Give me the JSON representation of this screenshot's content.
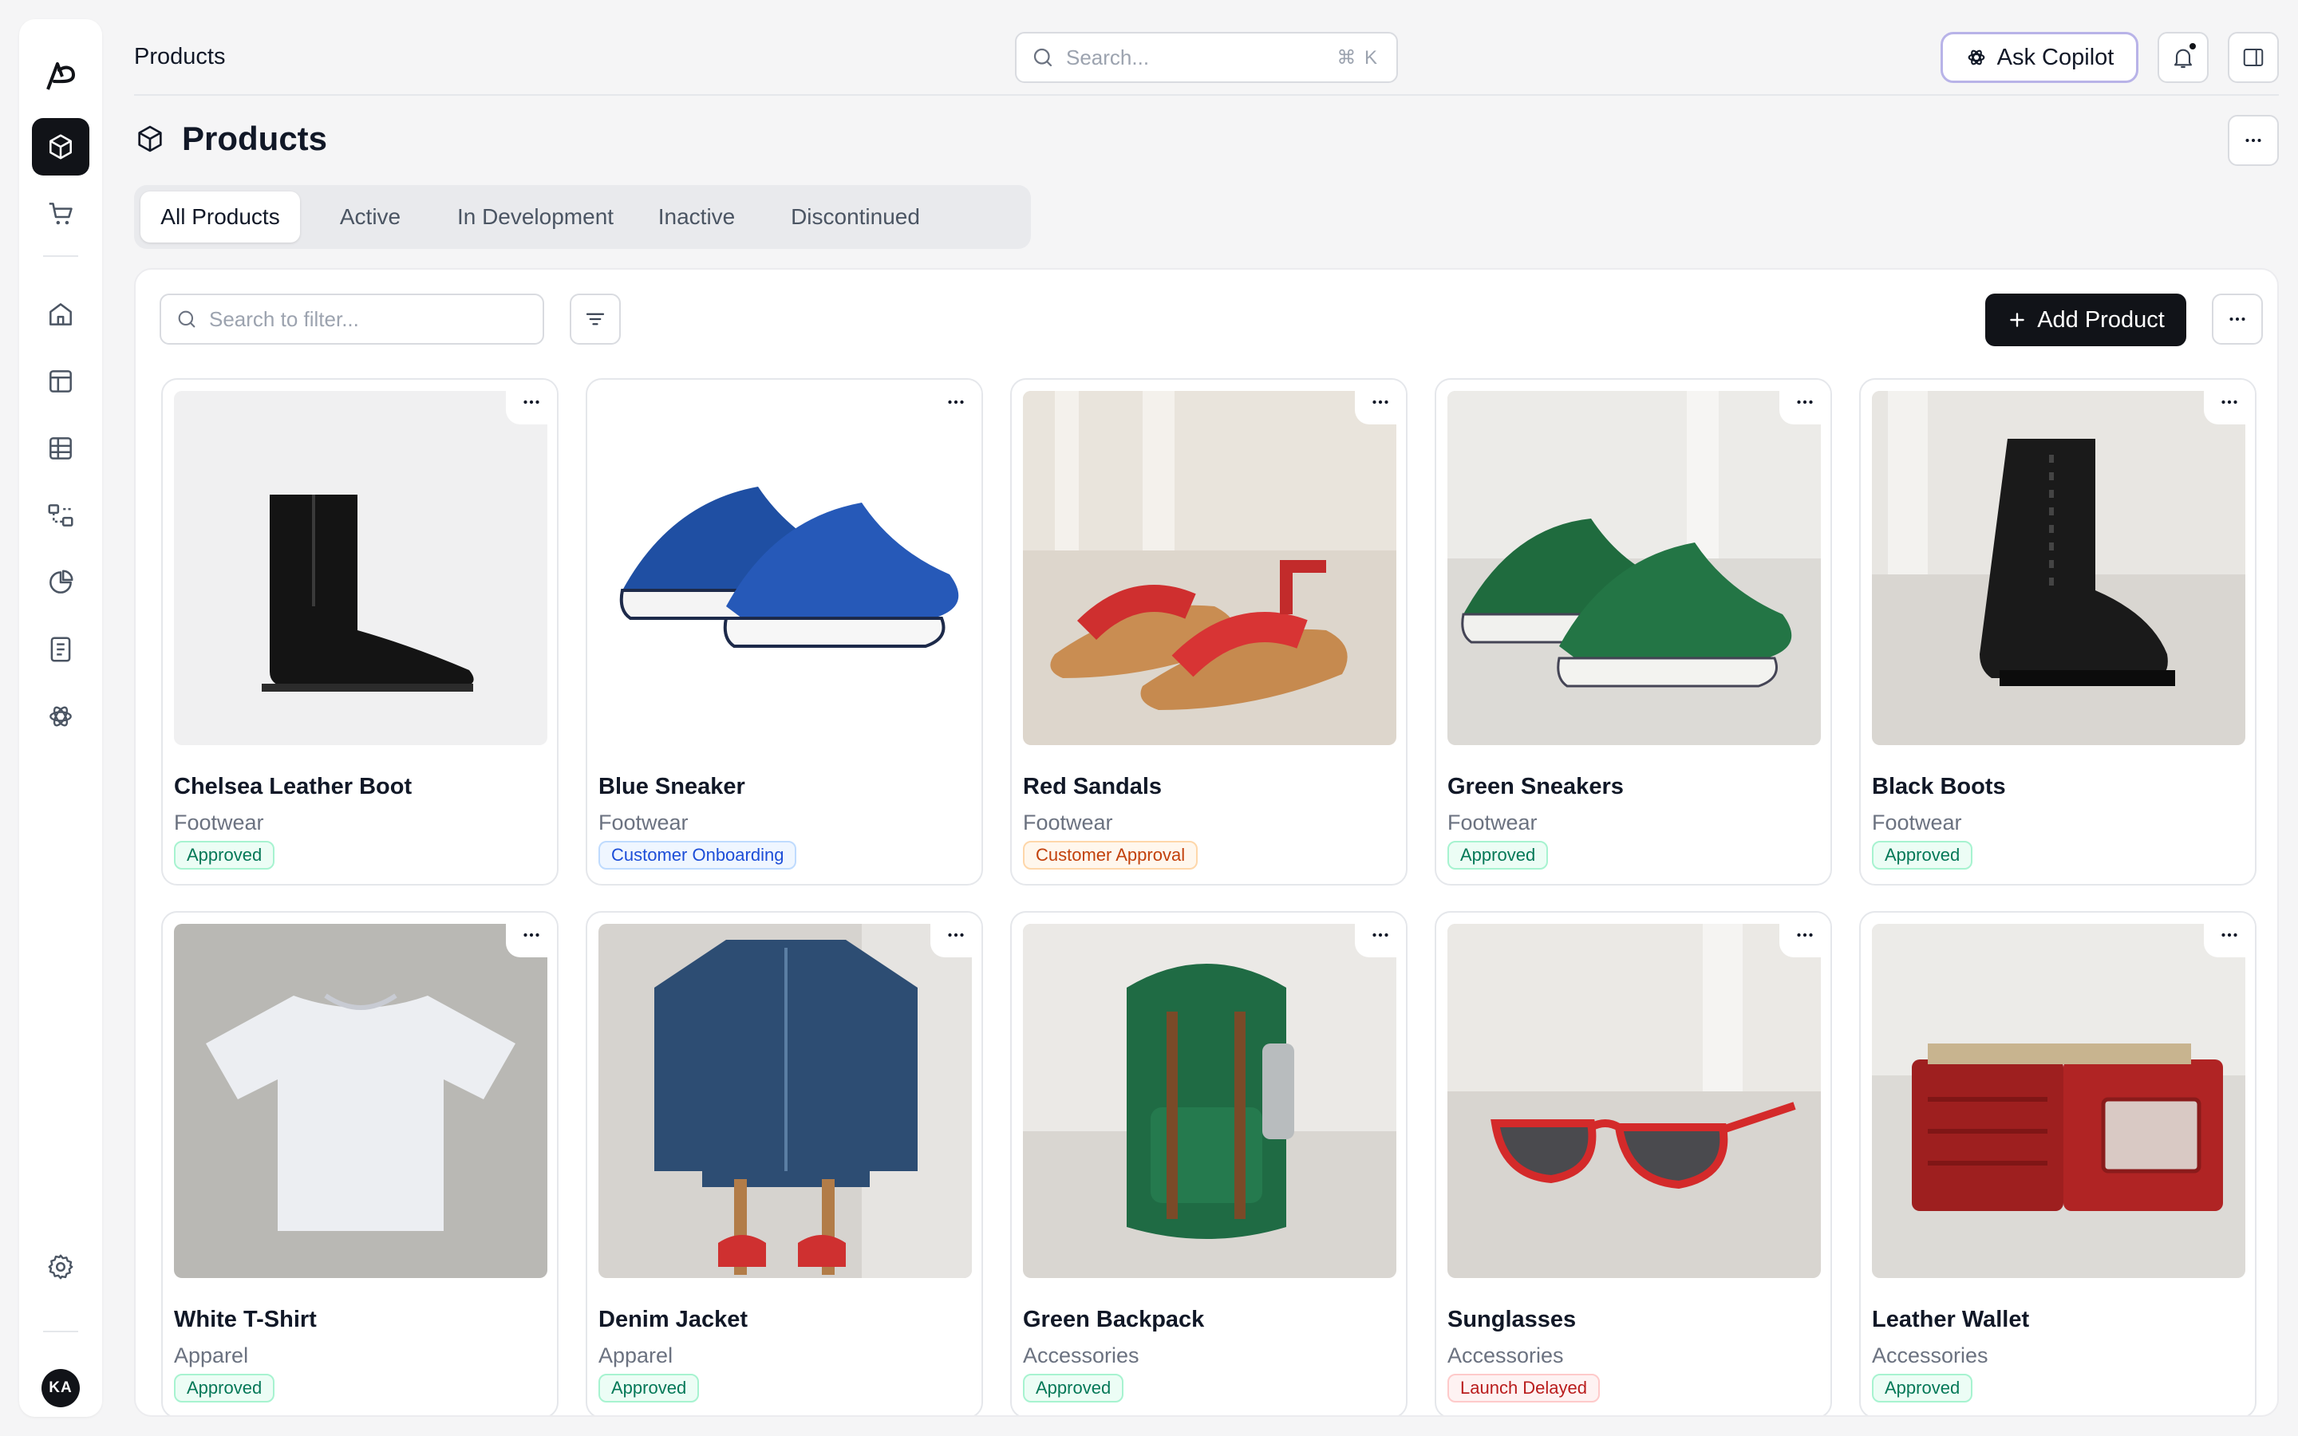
{
  "topbar": {
    "title": "Products",
    "search_placeholder": "Search...",
    "search_shortcut": "⌘ K",
    "copilot_label": "Ask Copilot"
  },
  "page": {
    "title": "Products"
  },
  "tabs": [
    {
      "label": "All Products",
      "active": true
    },
    {
      "label": "Active",
      "active": false
    },
    {
      "label": "In Development",
      "active": false
    },
    {
      "label": "Inactive",
      "active": false
    },
    {
      "label": "Discontinued",
      "active": false
    }
  ],
  "toolbar": {
    "filter_placeholder": "Search to filter...",
    "add_label": "Add Product"
  },
  "user": {
    "initials": "KA"
  },
  "products": [
    {
      "name": "Chelsea Leather Boot",
      "category": "Footwear",
      "status": "Approved",
      "status_kind": "approved"
    },
    {
      "name": "Blue Sneaker",
      "category": "Footwear",
      "status": "Customer Onboarding",
      "status_kind": "onboard"
    },
    {
      "name": "Red Sandals",
      "category": "Footwear",
      "status": "Customer Approval",
      "status_kind": "custappr"
    },
    {
      "name": "Green Sneakers",
      "category": "Footwear",
      "status": "Approved",
      "status_kind": "approved"
    },
    {
      "name": "Black Boots",
      "category": "Footwear",
      "status": "Approved",
      "status_kind": "approved"
    },
    {
      "name": "White T-Shirt",
      "category": "Apparel",
      "status": "Approved",
      "status_kind": "approved"
    },
    {
      "name": "Denim Jacket",
      "category": "Apparel",
      "status": "Approved",
      "status_kind": "approved"
    },
    {
      "name": "Green Backpack",
      "category": "Accessories",
      "status": "Approved",
      "status_kind": "approved"
    },
    {
      "name": "Sunglasses",
      "category": "Accessories",
      "status": "Launch Delayed",
      "status_kind": "delayed"
    },
    {
      "name": "Leather Wallet",
      "category": "Accessories",
      "status": "Approved",
      "status_kind": "approved"
    }
  ],
  "colors": {
    "primary": "#111318",
    "copilot_border": "#b8b3e8",
    "approved": "#047857",
    "onboarding": "#1d4ed8",
    "customer_approval": "#c2410c",
    "delayed": "#b91c1c"
  }
}
